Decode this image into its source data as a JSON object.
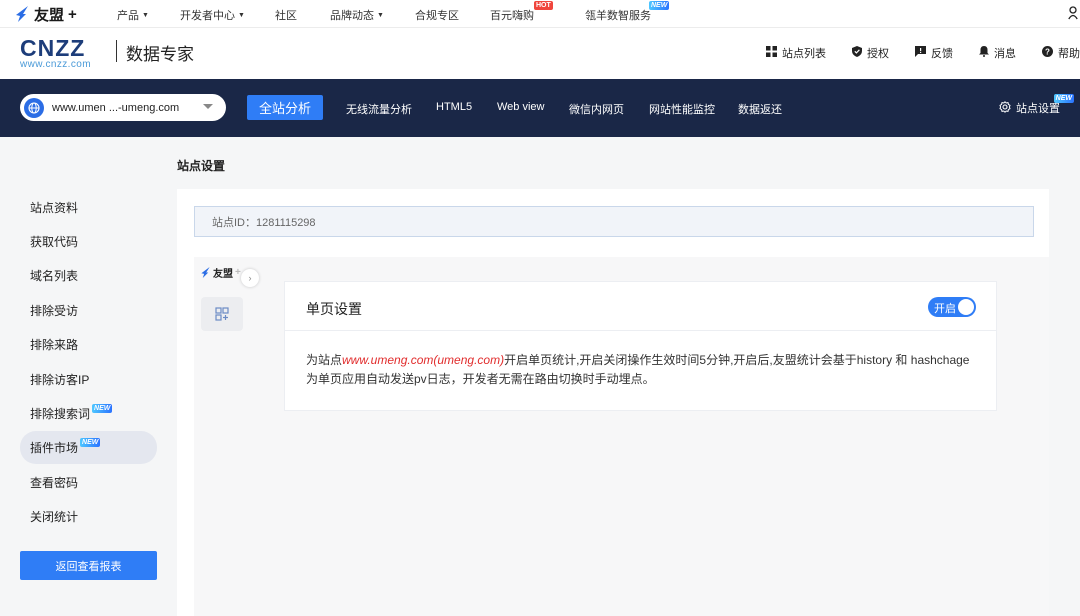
{
  "topbar": {
    "logo_text": "友盟",
    "logo_plus": "+",
    "nav": [
      {
        "label": "产品",
        "caret": true
      },
      {
        "label": "开发者中心",
        "caret": true
      },
      {
        "label": "社区",
        "caret": false
      },
      {
        "label": "品牌动态",
        "caret": true
      },
      {
        "label": "合规专区",
        "caret": false
      },
      {
        "label": "百元嗨购",
        "caret": false,
        "badge": "HOT"
      },
      {
        "label": "瓴羊数智服务",
        "caret": false,
        "badge": "NEW"
      }
    ]
  },
  "header": {
    "brand_big": "CNZZ",
    "brand_small": "www.cnzz.com",
    "title": "数据专家",
    "actions": [
      {
        "icon": "grid-icon",
        "label": "站点列表"
      },
      {
        "icon": "shield-icon",
        "label": "授权"
      },
      {
        "icon": "feedback-icon",
        "label": "反馈"
      },
      {
        "icon": "bell-icon",
        "label": "消息"
      },
      {
        "icon": "help-icon",
        "label": "帮助"
      }
    ]
  },
  "darknav": {
    "site_value": "www.umen ...-umeng.com",
    "primary": "全站分析",
    "items": [
      "无线流量分析",
      "HTML5",
      "Web view",
      "微信内网页",
      "网站性能监控",
      "数据返还"
    ],
    "settings": "站点设置",
    "settings_badge": "NEW"
  },
  "sidebar": {
    "items": [
      {
        "label": "站点资料"
      },
      {
        "label": "获取代码"
      },
      {
        "label": "域名列表"
      },
      {
        "label": "排除受访"
      },
      {
        "label": "排除来路"
      },
      {
        "label": "排除访客IP"
      },
      {
        "label": "排除搜索词",
        "badge": "NEW"
      },
      {
        "label": "插件市场",
        "badge": "NEW",
        "active": true
      },
      {
        "label": "查看密码"
      },
      {
        "label": "关闭统计"
      }
    ],
    "back_button": "返回查看报表"
  },
  "main": {
    "page_title": "站点设置",
    "site_id": "站点ID：1281115298",
    "plugin_logo": "友盟",
    "plugin_logo_trail": "+",
    "card": {
      "title": "单页设置",
      "toggle_label": "开启",
      "toggle_on": true,
      "text_before": "为站点",
      "site_link": "www.umeng.com(umeng.com)",
      "text_after": "开启单页统计,开启关闭操作生效时间5分钟,开启后,友盟统计会基于history 和 hashchage 为单页应用自动发送pv日志，开发者无需在路由切换时手动埋点。"
    }
  },
  "colors": {
    "accent": "#2f7df6",
    "nav_bg": "#1a2747",
    "brand": "#1d3d7a",
    "link_red": "#e12c2c"
  }
}
